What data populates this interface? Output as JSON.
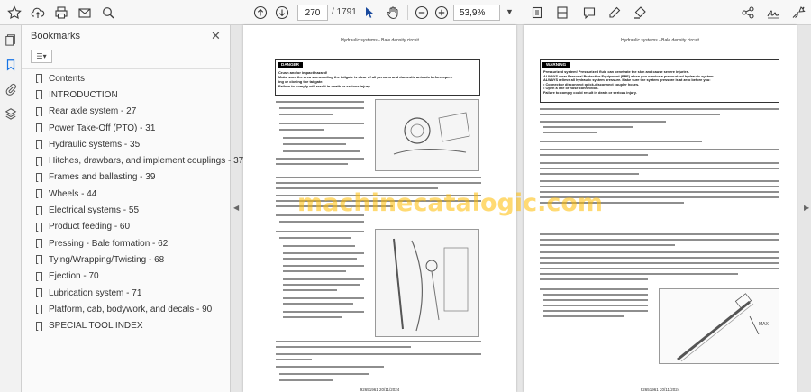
{
  "toolbar": {
    "current_page": "270",
    "total_pages": "/ 1791",
    "zoom": "53,9%"
  },
  "panel": {
    "title": "Bookmarks",
    "bookmarks": [
      "Contents",
      "INTRODUCTION",
      "Rear axle system - 27",
      "Power Take-Off (PTO) - 31",
      "Hydraulic systems - 35",
      "Hitches, drawbars, and implement couplings - 37",
      "Frames and ballasting - 39",
      "Wheels - 44",
      "Electrical systems - 55",
      "Product feeding - 60",
      "Pressing - Bale formation - 62",
      "Tying/Wrapping/Twisting - 68",
      "Ejection - 70",
      "Lubrication system - 71",
      "Platform, cab, bodywork, and decals - 90",
      "SPECIAL TOOL INDEX"
    ]
  },
  "doc": {
    "header": "Hydraulic systems - Bale density circuit",
    "left": {
      "warn_label": "DANGER",
      "warn_lines": [
        "Crush and/or impact hazard!",
        "Make sure the area surrounding the tailgate is clear of all persons and domestic animals before open-",
        "ing or closing the tailgate.",
        "Failure to comply will result in death or serious injury."
      ],
      "footer_code": "92651961 20/11/2024",
      "footer_page": "35.3 [35.640] / 38"
    },
    "right": {
      "warn_label": "WARNING",
      "warn_lines": [
        "Pressurized system! Pressurized fluid can penetrate the skin and cause severe injuries.",
        "ALWAYS wear Personal Protective Equipment (PPE) when you service a pressurized hydraulic system.",
        "ALWAYS relieve all hydraulic system pressure. Make sure the system pressure is at zero before you:",
        "• Connect or disconnect quick-disconnect coupler hoses.",
        "• Open a line or hose connection.",
        "Failure to comply could result in death or serious injury."
      ],
      "footer_code": "92651961 20/11/2024",
      "footer_page": "35.3 [35.640] / 39"
    },
    "watermark": "machinecatalogic.com"
  },
  "colors": {
    "toolbar_bg": "#f7f7f7",
    "panel_bg": "#fafafa",
    "canvas_bg": "#e6e6e6",
    "active_icon": "#1473e6",
    "watermark": "#ffbb00"
  }
}
